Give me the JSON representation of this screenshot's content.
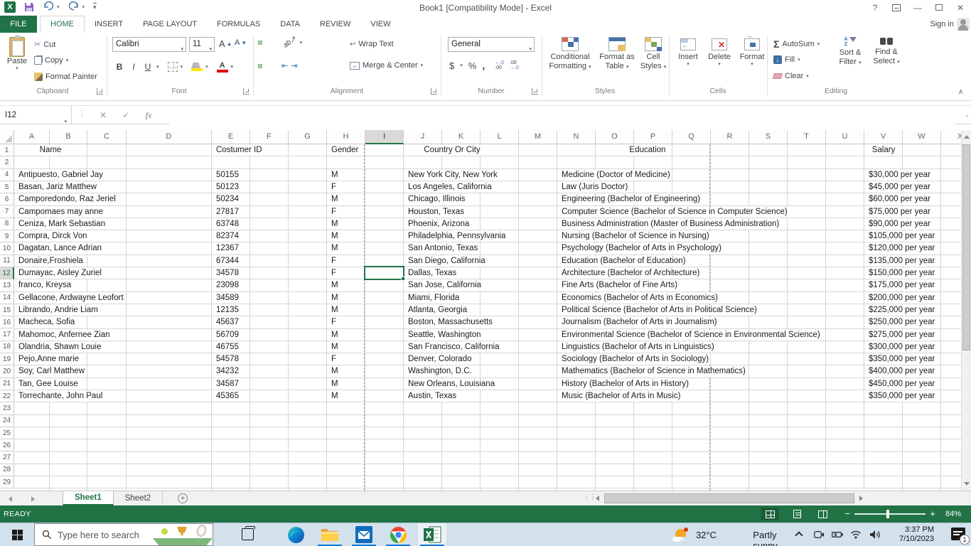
{
  "titlebar": {
    "title": "Book1  [Compatibility Mode] - Excel",
    "help": "?"
  },
  "tabs": {
    "file": "FILE",
    "items": [
      "HOME",
      "INSERT",
      "PAGE LAYOUT",
      "FORMULAS",
      "DATA",
      "REVIEW",
      "VIEW"
    ],
    "active": "HOME",
    "sign_in": "Sign in"
  },
  "ribbon": {
    "clipboard": {
      "label": "Clipboard",
      "paste": "Paste",
      "cut": "Cut",
      "copy": "Copy",
      "format_painter": "Format Painter"
    },
    "font": {
      "label": "Font",
      "font_name": "Calibri",
      "font_size": "11",
      "bold": "B",
      "italic": "I",
      "underline": "U",
      "grow": "A",
      "shrink": "A",
      "color_a": "A"
    },
    "alignment": {
      "label": "Alignment",
      "wrap_text": "Wrap Text",
      "merge_center": "Merge & Center",
      "orientation": "ab"
    },
    "number": {
      "label": "Number",
      "format": "General",
      "currency": "$",
      "percent": "%",
      "comma": ",",
      "inc_dec": "←.0",
      "inc_dec2": ".00",
      "dec_dec": ".00",
      "dec_dec2": "→.0"
    },
    "styles": {
      "label": "Styles",
      "conditional": "Conditional Formatting",
      "format_table": "Format as Table",
      "cell_styles": "Cell Styles"
    },
    "cells": {
      "label": "Cells",
      "insert": "Insert",
      "delete": "Delete",
      "format": "Format"
    },
    "editing": {
      "label": "Editing",
      "autosum": "AutoSum",
      "sigma": "Σ",
      "fill": "Fill",
      "clear": "Clear",
      "sort_filter": "Sort & Filter",
      "find_select": "Find & Select"
    }
  },
  "formula_bar": {
    "name_box": "I12",
    "fx": "fx",
    "value": ""
  },
  "sheet": {
    "selected_cell": "I12",
    "selected_col": "I",
    "selected_row": "12",
    "columns": [
      "A",
      "B",
      "C",
      "D",
      "E",
      "F",
      "G",
      "H",
      "I",
      "J",
      "K",
      "L",
      "M",
      "N",
      "O",
      "P",
      "Q",
      "R",
      "S",
      "T",
      "U",
      "V",
      "W",
      "X"
    ],
    "rows": [
      "1",
      "2",
      "4",
      "5",
      "6",
      "7",
      "8",
      "9",
      "10",
      "11",
      "12",
      "13",
      "14",
      "15",
      "16",
      "17",
      "18",
      "19",
      "20",
      "21",
      "22",
      "23",
      "24",
      "25",
      "26",
      "27",
      "28",
      "29"
    ],
    "headers": {
      "row": "1",
      "name": "Name",
      "id": "Costumer ID",
      "gender": "Gender",
      "city": "Country Or City",
      "education": "Education",
      "salary": "Salary"
    },
    "records": [
      {
        "row": "4",
        "name": "Antipuesto, Gabriel Jay",
        "id": "50155",
        "gender": "M",
        "city": "New York City, New York",
        "education": "Medicine (Doctor of Medicine)",
        "salary": "$30,000 per year"
      },
      {
        "row": "5",
        "name": "Basan, Jariz Matthew",
        "id": "50123",
        "gender": "F",
        "city": "Los Angeles, California",
        "education": "Law (Juris Doctor)",
        "salary": "$45,000 per year"
      },
      {
        "row": "6",
        "name": "Camporedondo, Raz Jeriel",
        "id": "50234",
        "gender": "M",
        "city": "Chicago, Illinois",
        "education": "Engineering (Bachelor of Engineering)",
        "salary": "$60,000 per year"
      },
      {
        "row": "7",
        "name": "Campomaes may anne",
        "id": "27817",
        "gender": "F",
        "city": "Houston, Texas",
        "education": "Computer Science (Bachelor of Science in Computer Science)",
        "salary": "$75,000 per year"
      },
      {
        "row": "8",
        "name": "Ceniza, Mark Sebastian",
        "id": "63748",
        "gender": "M",
        "city": "Phoenix, Arizona",
        "education": "Business Administration (Master of Business Administration)",
        "salary": "$90,000 per year"
      },
      {
        "row": "9",
        "name": "Compra, Dirck Von",
        "id": "82374",
        "gender": "M",
        "city": "Philadelphia, Pennsylvania",
        "education": "Nursing (Bachelor of Science in Nursing)",
        "salary": "$105,000 per year"
      },
      {
        "row": "10",
        "name": "Dagatan, Lance Adrian",
        "id": "12367",
        "gender": "M",
        "city": "San Antonio, Texas",
        "education": "Psychology (Bachelor of Arts in Psychology)",
        "salary": "$120,000 per year"
      },
      {
        "row": "11",
        "name": "Donaire,Froshiela",
        "id": "67344",
        "gender": "F",
        "city": "San Diego, California",
        "education": "Education (Bachelor of Education)",
        "salary": "$135,000 per year"
      },
      {
        "row": "12",
        "name": "Dumayac, Aisley Zuriel",
        "id": "34578",
        "gender": "F",
        "city": "Dallas, Texas",
        "education": "Architecture (Bachelor of Architecture)",
        "salary": "$150,000 per year"
      },
      {
        "row": "13",
        "name": "franco, Kreysa",
        "id": "23098",
        "gender": "M",
        "city": "San Jose, California",
        "education": "Fine Arts (Bachelor of Fine Arts)",
        "salary": "$175,000 per year"
      },
      {
        "row": "14",
        "name": "Gellacone, Ardwayne Leofort",
        "id": "34589",
        "gender": "M",
        "city": "Miami, Florida",
        "education": "Economics (Bachelor of Arts in Economics)",
        "salary": "$200,000 per year"
      },
      {
        "row": "15",
        "name": "Librando, Andrie Liam",
        "id": "12135",
        "gender": "M",
        "city": "Atlanta, Georgia",
        "education": "Political Science (Bachelor of Arts in Political Science)",
        "salary": "$225,000 per year"
      },
      {
        "row": "16",
        "name": "Macheca, Sofia",
        "id": "45637",
        "gender": "F",
        "city": "Boston, Massachusetts",
        "education": "Journalism (Bachelor of Arts in Journalism)",
        "salary": "$250,000 per year"
      },
      {
        "row": "17",
        "name": "Mahomoc, Anfernee Zian",
        "id": "56709",
        "gender": "M",
        "city": "Seattle, Washington",
        "education": "Environmental Science (Bachelor of Science in Environmental Science)",
        "salary": "$275,000 per year"
      },
      {
        "row": "18",
        "name": "Olandria, Shawn Louie",
        "id": "46755",
        "gender": "M",
        "city": "San Francisco, California",
        "education": "Linguistics (Bachelor of Arts in Linguistics)",
        "salary": "$300,000 per year"
      },
      {
        "row": "19",
        "name": "Pejo,Anne marie",
        "id": "54578",
        "gender": "F",
        "city": "Denver, Colorado",
        "education": "Sociology (Bachelor of Arts in Sociology)",
        "salary": "$350,000 per year"
      },
      {
        "row": "20",
        "name": "Soy, Carl Matthew",
        "id": "34232",
        "gender": "M",
        "city": "Washington, D.C.",
        "education": "Mathematics (Bachelor of Science in Mathematics)",
        "salary": "$400,000 per year"
      },
      {
        "row": "21",
        "name": "Tan, Gee Louise",
        "id": "34587",
        "gender": "M",
        "city": "New Orleans, Louisiana",
        "education": "History (Bachelor of Arts in History)",
        "salary": "$450,000 per year"
      },
      {
        "row": "22",
        "name": "Torrechante, John Paul",
        "id": "45365",
        "gender": "M",
        "city": "Austin, Texas",
        "education": "Music (Bachelor of Arts in Music)",
        "salary": "$350,000 per year"
      }
    ]
  },
  "sheet_tabs": {
    "items": [
      "Sheet1",
      "Sheet2"
    ],
    "active": "Sheet1"
  },
  "status": {
    "mode": "READY",
    "zoom": "84%"
  },
  "taskbar": {
    "search_placeholder": "Type here to search",
    "weather_temp": "32°C",
    "weather_text": "Partly sunny",
    "time": "3:37 PM",
    "date": "7/10/2023",
    "notif_badge": "1"
  }
}
